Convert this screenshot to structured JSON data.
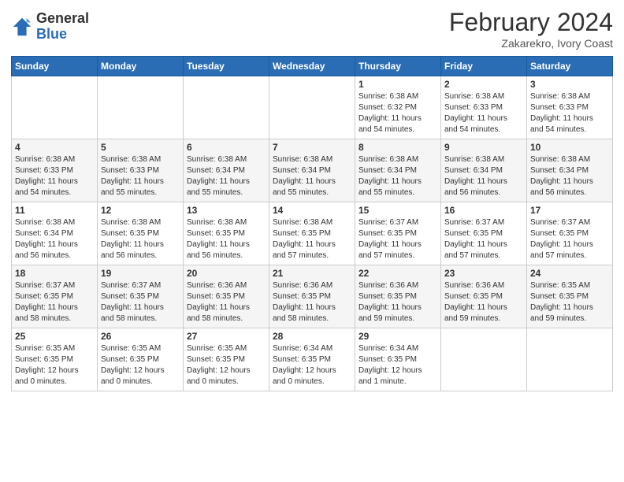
{
  "header": {
    "logo_general": "General",
    "logo_blue": "Blue",
    "month_title": "February 2024",
    "subtitle": "Zakarekro, Ivory Coast"
  },
  "days_of_week": [
    "Sunday",
    "Monday",
    "Tuesday",
    "Wednesday",
    "Thursday",
    "Friday",
    "Saturday"
  ],
  "weeks": [
    [
      {
        "day": "",
        "info": ""
      },
      {
        "day": "",
        "info": ""
      },
      {
        "day": "",
        "info": ""
      },
      {
        "day": "",
        "info": ""
      },
      {
        "day": "1",
        "info": "Sunrise: 6:38 AM\nSunset: 6:32 PM\nDaylight: 11 hours\nand 54 minutes."
      },
      {
        "day": "2",
        "info": "Sunrise: 6:38 AM\nSunset: 6:33 PM\nDaylight: 11 hours\nand 54 minutes."
      },
      {
        "day": "3",
        "info": "Sunrise: 6:38 AM\nSunset: 6:33 PM\nDaylight: 11 hours\nand 54 minutes."
      }
    ],
    [
      {
        "day": "4",
        "info": "Sunrise: 6:38 AM\nSunset: 6:33 PM\nDaylight: 11 hours\nand 54 minutes."
      },
      {
        "day": "5",
        "info": "Sunrise: 6:38 AM\nSunset: 6:33 PM\nDaylight: 11 hours\nand 55 minutes."
      },
      {
        "day": "6",
        "info": "Sunrise: 6:38 AM\nSunset: 6:34 PM\nDaylight: 11 hours\nand 55 minutes."
      },
      {
        "day": "7",
        "info": "Sunrise: 6:38 AM\nSunset: 6:34 PM\nDaylight: 11 hours\nand 55 minutes."
      },
      {
        "day": "8",
        "info": "Sunrise: 6:38 AM\nSunset: 6:34 PM\nDaylight: 11 hours\nand 55 minutes."
      },
      {
        "day": "9",
        "info": "Sunrise: 6:38 AM\nSunset: 6:34 PM\nDaylight: 11 hours\nand 56 minutes."
      },
      {
        "day": "10",
        "info": "Sunrise: 6:38 AM\nSunset: 6:34 PM\nDaylight: 11 hours\nand 56 minutes."
      }
    ],
    [
      {
        "day": "11",
        "info": "Sunrise: 6:38 AM\nSunset: 6:34 PM\nDaylight: 11 hours\nand 56 minutes."
      },
      {
        "day": "12",
        "info": "Sunrise: 6:38 AM\nSunset: 6:35 PM\nDaylight: 11 hours\nand 56 minutes."
      },
      {
        "day": "13",
        "info": "Sunrise: 6:38 AM\nSunset: 6:35 PM\nDaylight: 11 hours\nand 56 minutes."
      },
      {
        "day": "14",
        "info": "Sunrise: 6:38 AM\nSunset: 6:35 PM\nDaylight: 11 hours\nand 57 minutes."
      },
      {
        "day": "15",
        "info": "Sunrise: 6:37 AM\nSunset: 6:35 PM\nDaylight: 11 hours\nand 57 minutes."
      },
      {
        "day": "16",
        "info": "Sunrise: 6:37 AM\nSunset: 6:35 PM\nDaylight: 11 hours\nand 57 minutes."
      },
      {
        "day": "17",
        "info": "Sunrise: 6:37 AM\nSunset: 6:35 PM\nDaylight: 11 hours\nand 57 minutes."
      }
    ],
    [
      {
        "day": "18",
        "info": "Sunrise: 6:37 AM\nSunset: 6:35 PM\nDaylight: 11 hours\nand 58 minutes."
      },
      {
        "day": "19",
        "info": "Sunrise: 6:37 AM\nSunset: 6:35 PM\nDaylight: 11 hours\nand 58 minutes."
      },
      {
        "day": "20",
        "info": "Sunrise: 6:36 AM\nSunset: 6:35 PM\nDaylight: 11 hours\nand 58 minutes."
      },
      {
        "day": "21",
        "info": "Sunrise: 6:36 AM\nSunset: 6:35 PM\nDaylight: 11 hours\nand 58 minutes."
      },
      {
        "day": "22",
        "info": "Sunrise: 6:36 AM\nSunset: 6:35 PM\nDaylight: 11 hours\nand 59 minutes."
      },
      {
        "day": "23",
        "info": "Sunrise: 6:36 AM\nSunset: 6:35 PM\nDaylight: 11 hours\nand 59 minutes."
      },
      {
        "day": "24",
        "info": "Sunrise: 6:35 AM\nSunset: 6:35 PM\nDaylight: 11 hours\nand 59 minutes."
      }
    ],
    [
      {
        "day": "25",
        "info": "Sunrise: 6:35 AM\nSunset: 6:35 PM\nDaylight: 12 hours\nand 0 minutes."
      },
      {
        "day": "26",
        "info": "Sunrise: 6:35 AM\nSunset: 6:35 PM\nDaylight: 12 hours\nand 0 minutes."
      },
      {
        "day": "27",
        "info": "Sunrise: 6:35 AM\nSunset: 6:35 PM\nDaylight: 12 hours\nand 0 minutes."
      },
      {
        "day": "28",
        "info": "Sunrise: 6:34 AM\nSunset: 6:35 PM\nDaylight: 12 hours\nand 0 minutes."
      },
      {
        "day": "29",
        "info": "Sunrise: 6:34 AM\nSunset: 6:35 PM\nDaylight: 12 hours\nand 1 minute."
      },
      {
        "day": "",
        "info": ""
      },
      {
        "day": "",
        "info": ""
      }
    ]
  ]
}
